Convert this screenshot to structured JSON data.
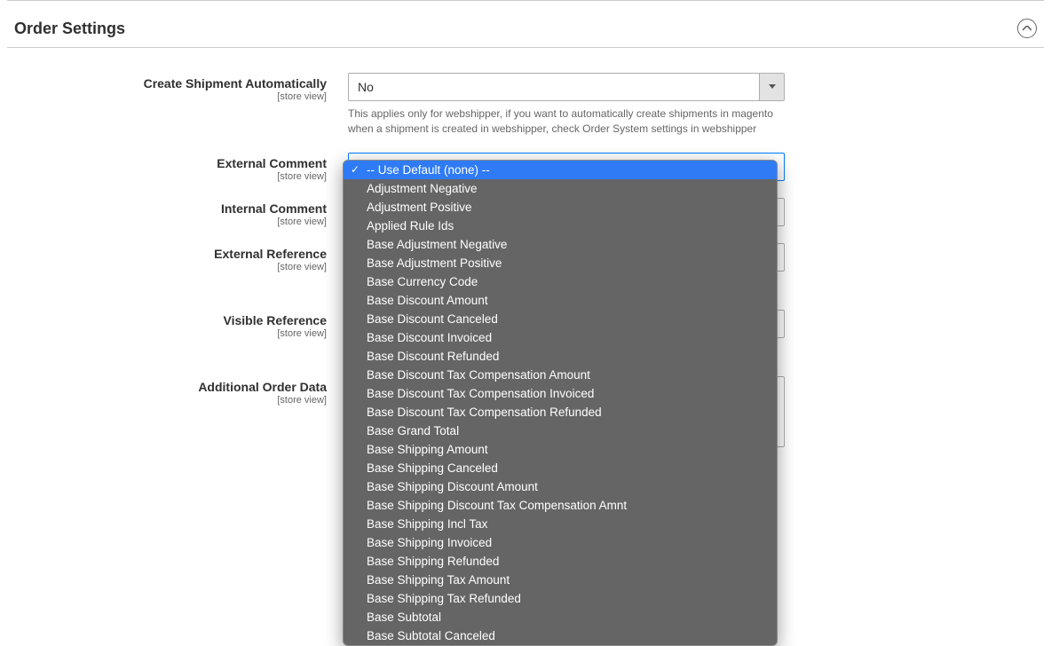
{
  "section": {
    "title": "Order Settings"
  },
  "fields": {
    "create_shipment": {
      "label": "Create Shipment Automatically",
      "scope": "[store view]",
      "value": "No",
      "help": "This applies only for webshipper, if you want to automatically create shipments in magento when a shipment is created in webshipper, check Order System settings in webshipper"
    },
    "external_comment": {
      "label": "External Comment",
      "scope": "[store view]"
    },
    "internal_comment": {
      "label": "Internal Comment",
      "scope": "[store view]"
    },
    "external_reference": {
      "label": "External Reference",
      "scope": "[store view]"
    },
    "visible_reference": {
      "label": "Visible Reference",
      "scope": "[store view]"
    },
    "additional_order_data": {
      "label": "Additional Order Data",
      "scope": "[store view]"
    }
  },
  "dropdown": {
    "options": [
      "-- Use Default (none) --",
      "Adjustment Negative",
      "Adjustment Positive",
      "Applied Rule Ids",
      "Base Adjustment Negative",
      "Base Adjustment Positive",
      "Base Currency Code",
      "Base Discount Amount",
      "Base Discount Canceled",
      "Base Discount Invoiced",
      "Base Discount Refunded",
      "Base Discount Tax Compensation Amount",
      "Base Discount Tax Compensation Invoiced",
      "Base Discount Tax Compensation Refunded",
      "Base Grand Total",
      "Base Shipping Amount",
      "Base Shipping Canceled",
      "Base Shipping Discount Amount",
      "Base Shipping Discount Tax Compensation Amnt",
      "Base Shipping Incl Tax",
      "Base Shipping Invoiced",
      "Base Shipping Refunded",
      "Base Shipping Tax Amount",
      "Base Shipping Tax Refunded",
      "Base Subtotal",
      "Base Subtotal Canceled"
    ],
    "selected_index": 0
  }
}
